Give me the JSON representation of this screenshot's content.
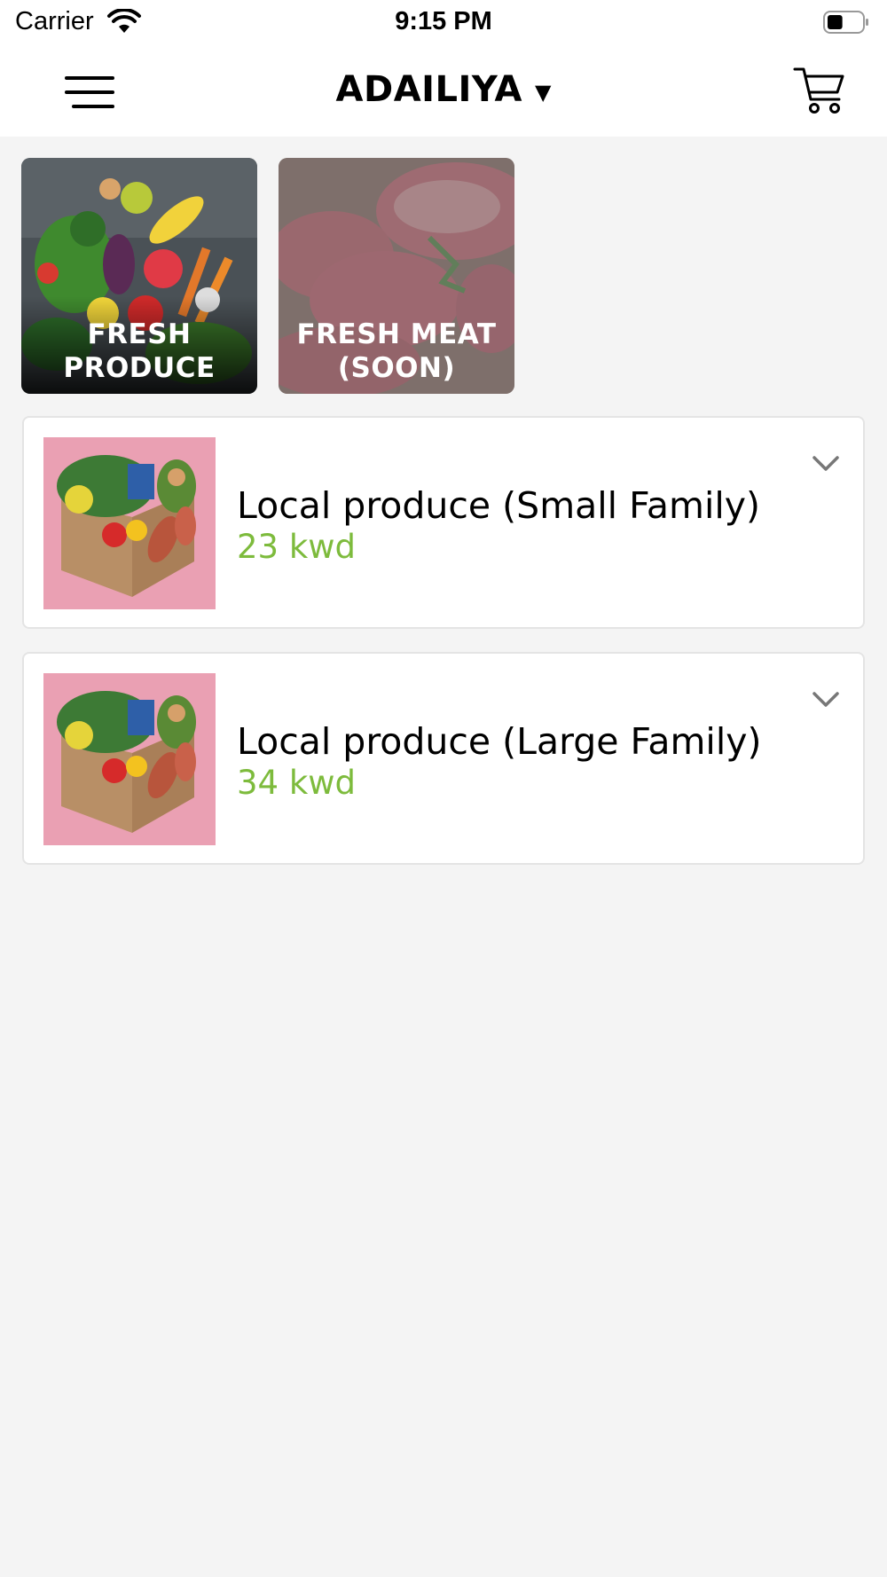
{
  "status_bar": {
    "carrier": "Carrier",
    "time": "9:15 PM",
    "wifi_icon": "wifi-icon",
    "battery_icon": "battery-icon",
    "battery_level": 0.45
  },
  "nav_bar": {
    "menu_icon": "hamburger-menu-icon",
    "location": "ADAILIYA",
    "location_caret": "▼",
    "cart_icon": "shopping-cart-icon"
  },
  "categories": [
    {
      "label": "FRESH\nPRODUCE",
      "image": "vegetables-photo",
      "enabled": true
    },
    {
      "label": "FRESH MEAT\n(SOON)",
      "image": "raw-meat-photo",
      "enabled": false
    }
  ],
  "products": [
    {
      "name": "Local produce (Small Family)",
      "price": "23 kwd",
      "image": "produce-box-photo",
      "expand_icon": "chevron-down-icon"
    },
    {
      "name": "Local produce (Large Family)",
      "price": "34 kwd",
      "image": "produce-box-photo",
      "expand_icon": "chevron-down-icon"
    }
  ],
  "colors": {
    "price_green": "#7dbb3c",
    "background": "#f4f4f4",
    "card_border": "#e4e4e4"
  }
}
